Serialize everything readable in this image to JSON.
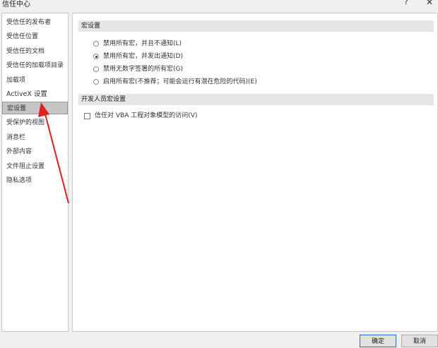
{
  "window": {
    "title": "信任中心",
    "help_glyph": "?",
    "close_glyph": "✕"
  },
  "sidebar": {
    "items": [
      {
        "label": "受信任的发布者"
      },
      {
        "label": "受信任位置"
      },
      {
        "label": "受信任的文档"
      },
      {
        "label": "受信任的加载项目录"
      },
      {
        "label": "加载项"
      },
      {
        "label": "ActiveX 设置"
      },
      {
        "label": "宏设置",
        "selected": true
      },
      {
        "label": "受保护的视图"
      },
      {
        "label": "消息栏"
      },
      {
        "label": "外部内容"
      },
      {
        "label": "文件阻止设置"
      },
      {
        "label": "隐私选项"
      }
    ]
  },
  "macro_settings": {
    "header": "宏设置",
    "options": [
      {
        "label": "禁用所有宏，并且不通知(L)",
        "checked": false
      },
      {
        "label": "禁用所有宏，并发出通知(D)",
        "checked": true
      },
      {
        "label": "禁用无数字签署的所有宏(G)",
        "checked": false
      },
      {
        "label": "启用所有宏(不推荐；可能会运行有潜在危险的代码)(E)",
        "checked": false
      }
    ]
  },
  "developer_settings": {
    "header": "开发人员宏设置",
    "checkbox_label": "信任对 VBA 工程对象模型的访问(V)",
    "checked": false
  },
  "buttons": {
    "ok": "确定",
    "cancel": "取消"
  },
  "annotation": {
    "arrow_color": "#e02020"
  }
}
